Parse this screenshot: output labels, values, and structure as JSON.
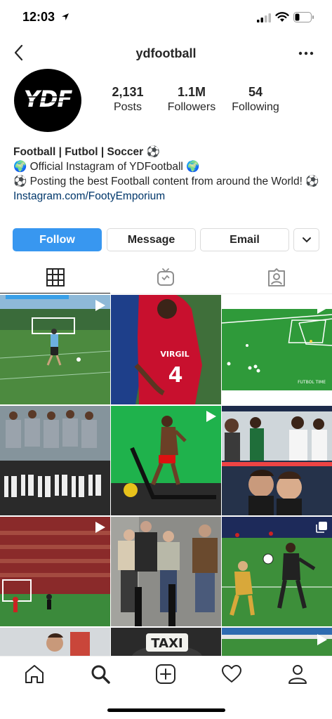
{
  "status_bar": {
    "time": "12:03"
  },
  "header": {
    "username": "ydfootball"
  },
  "profile": {
    "avatar_text": "YDF",
    "stats": [
      {
        "value": "2,131",
        "label": "Posts"
      },
      {
        "value": "1.1M",
        "label": "Followers"
      },
      {
        "value": "54",
        "label": "Following"
      }
    ],
    "bio": {
      "name": "Football | Futbol | Soccer ⚽",
      "line1": "🌍 Official Instagram of YDFootball 🌍",
      "line2": "⚽ Posting the best Football content from around the World! ⚽",
      "link": "Instagram.com/FootyEmporium"
    }
  },
  "actions": {
    "follow": "Follow",
    "message": "Message",
    "email": "Email"
  },
  "tabs": [
    "grid-icon",
    "igtv-icon",
    "tagged-icon"
  ],
  "grid": {
    "posts": [
      {
        "type": "video"
      },
      {
        "type": "image",
        "jersey_name": "VIRGIL",
        "jersey_number": "4"
      },
      {
        "type": "video",
        "watermark": "FUTBOL TIME"
      },
      {
        "type": "image"
      },
      {
        "type": "video"
      },
      {
        "type": "image"
      },
      {
        "type": "video"
      },
      {
        "type": "image"
      },
      {
        "type": "carousel"
      },
      {
        "type": "image"
      },
      {
        "type": "image",
        "sign": "TAXI"
      },
      {
        "type": "video"
      }
    ]
  },
  "bottom_nav": [
    "home-icon",
    "search-icon",
    "new-post-icon",
    "activity-icon",
    "profile-icon"
  ],
  "colors": {
    "accent": "#3897f0",
    "link": "#00376b",
    "text": "#262626",
    "border": "#dbdbdb"
  }
}
